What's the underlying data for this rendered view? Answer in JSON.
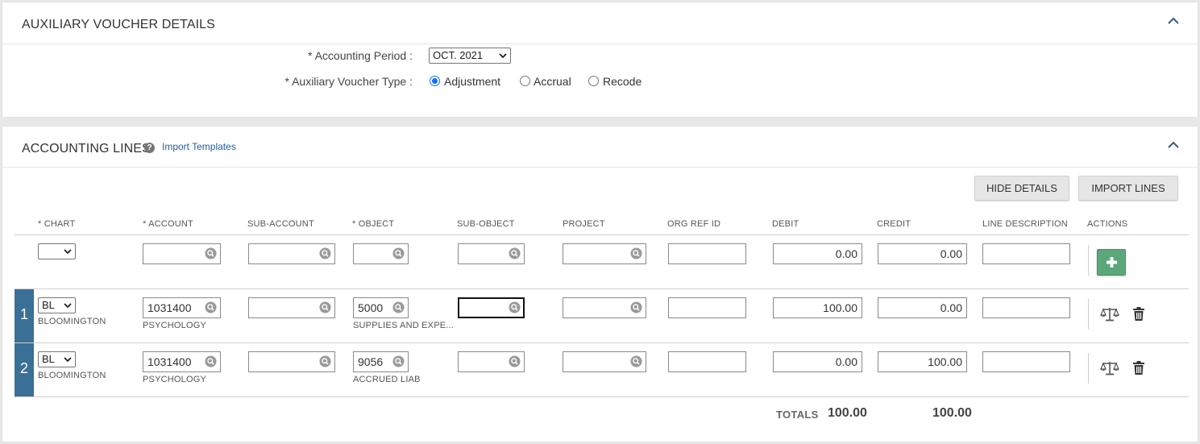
{
  "voucher_details": {
    "title": "AUXILIARY VOUCHER DETAILS",
    "period_label": "* Accounting Period :",
    "period_value": "OCT. 2021",
    "type_label": "* Auxiliary Voucher Type :",
    "types": [
      "Adjustment",
      "Accrual",
      "Recode"
    ],
    "selected_type": "Adjustment"
  },
  "accounting_lines": {
    "title": "ACCOUNTING LINES",
    "help_icon": "?",
    "import_templates_link": "Import Templates",
    "hide_details_button": "HIDE DETAILS",
    "import_lines_button": "IMPORT LINES",
    "columns": [
      "* CHART",
      "* ACCOUNT",
      "SUB-ACCOUNT",
      "* OBJECT",
      "SUB-OBJECT",
      "PROJECT",
      "ORG REF ID",
      "DEBIT",
      "CREDIT",
      "LINE DESCRIPTION",
      "ACTIONS"
    ],
    "new_line": {
      "chart": "",
      "account": "",
      "sub_account": "",
      "object": "",
      "sub_object": "",
      "project": "",
      "org_ref_id": "",
      "debit": "0.00",
      "credit": "0.00",
      "line_description": ""
    },
    "lines": [
      {
        "num": "1",
        "chart": "BL",
        "chart_name": "BLOOMINGTON",
        "account": "1031400",
        "account_name": "PSYCHOLOGY",
        "sub_account": "",
        "object": "5000",
        "object_name": "SUPPLIES AND EXPE...",
        "sub_object": "",
        "project": "",
        "org_ref_id": "",
        "debit": "100.00",
        "credit": "0.00",
        "line_description": ""
      },
      {
        "num": "2",
        "chart": "BL",
        "chart_name": "BLOOMINGTON",
        "account": "1031400",
        "account_name": "PSYCHOLOGY",
        "sub_account": "",
        "object": "9056",
        "object_name": "ACCRUED LIAB",
        "sub_object": "",
        "project": "",
        "org_ref_id": "",
        "debit": "0.00",
        "credit": "100.00",
        "line_description": ""
      }
    ],
    "totals_label": "TOTALS",
    "total_debit": "100.00",
    "total_credit": "100.00"
  },
  "colors": {
    "accent_blue": "#3a6f96",
    "add_green": "#5aa77a",
    "link_blue": "#1f5fa8"
  }
}
